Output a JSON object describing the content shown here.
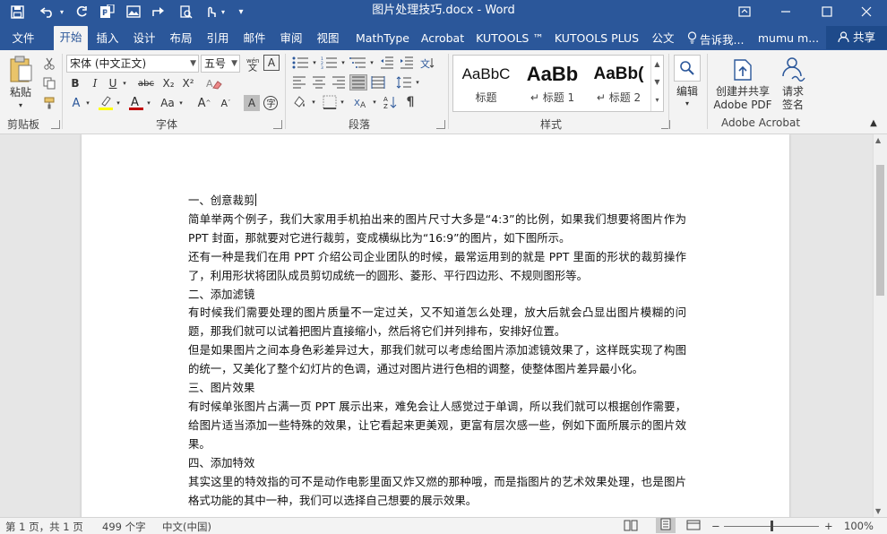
{
  "window": {
    "title": "图片处理技巧.docx - Word",
    "quick_access": [
      "save-icon",
      "undo-icon",
      "redo-icon",
      "pdf-icon",
      "picture-icon",
      "share-icon",
      "print-preview-icon",
      "touch-mode-icon",
      "customize-icon"
    ],
    "controls": [
      "ribbon-display-icon",
      "minimize-icon",
      "maximize-icon",
      "close-icon"
    ]
  },
  "tabs": [
    {
      "label": "文件",
      "active": false
    },
    {
      "label": "开始",
      "active": true
    },
    {
      "label": "插入",
      "active": false
    },
    {
      "label": "设计",
      "active": false
    },
    {
      "label": "布局",
      "active": false
    },
    {
      "label": "引用",
      "active": false
    },
    {
      "label": "邮件",
      "active": false
    },
    {
      "label": "审阅",
      "active": false
    },
    {
      "label": "视图",
      "active": false
    },
    {
      "label": "MathType",
      "active": false
    },
    {
      "label": "Acrobat",
      "active": false
    },
    {
      "label": "KUTOOLS ™",
      "active": false
    },
    {
      "label": "KUTOOLS PLUS",
      "active": false
    },
    {
      "label": "公文",
      "active": false
    }
  ],
  "tell_me": "告诉我...",
  "user": "mumu m...",
  "share": "共享",
  "ribbon": {
    "clipboard": {
      "paste": "粘贴",
      "label": "剪贴板"
    },
    "font": {
      "name": "宋体 (中文正文)",
      "size": "五号",
      "label": "字体",
      "buttons": [
        "B",
        "I",
        "U",
        "abc",
        "X₂",
        "X²",
        "Aa",
        "A"
      ]
    },
    "paragraph": {
      "label": "段落"
    },
    "styles": {
      "label": "样式",
      "items": [
        {
          "sample": "AaBbC",
          "name": "标题"
        },
        {
          "sample": "AaBb",
          "name": "↵ 标题 1"
        },
        {
          "sample": "AaBb(",
          "name": "↵ 标题 2"
        }
      ]
    },
    "editing": {
      "label": "编辑"
    },
    "acrobat": {
      "create_share_line1": "创建并共享",
      "create_share_line2": "Adobe PDF",
      "sign_line1": "请求",
      "sign_line2": "签名",
      "label": "Adobe Acrobat"
    }
  },
  "document": {
    "paragraphs": [
      "一、创意裁剪",
      "简单举两个例子，我们大家用手机拍出来的图片尺寸大多是“4:3”的比例，如果我们想要将图片作为 PPT 封面，那就要对它进行裁剪，变成横纵比为“16:9”的图片，如下图所示。",
      "还有一种是我们在用 PPT 介绍公司企业团队的时候，最常运用到的就是 PPT 里面的形状的裁剪操作了，利用形状将团队成员剪切成统一的圆形、菱形、平行四边形、不规则图形等。",
      "二、添加滤镜",
      "有时候我们需要处理的图片质量不一定过关，又不知道怎么处理，放大后就会凸显出图片模糊的问题，那我们就可以试着把图片直接缩小，然后将它们并列排布，安排好位置。",
      "但是如果图片之间本身色彩差异过大，那我们就可以考虑给图片添加滤镜效果了，这样既实现了构图的统一，又美化了整个幻灯片的色调，通过对图片进行色相的调整，使整体图片差异最小化。",
      "三、图片效果",
      "有时候单张图片占满一页 PPT 展示出来，难免会让人感觉过于单调，所以我们就可以根据创作需要，给图片适当添加一些特殊的效果，让它看起来更美观，更富有层次感一些，例如下面所展示的图片效果。",
      "四、添加特效",
      "其实这里的特效指的可不是动作电影里面又炸又燃的那种哦，而是指图片的艺术效果处理，也是图片格式功能的其中一种，我们可以选择自己想要的展示效果。"
    ]
  },
  "status": {
    "page": "第 1 页，共 1 页",
    "words": "499 个字",
    "language": "中文(中国)",
    "zoom": "100%",
    "zoom_level": 1.0
  },
  "colors": {
    "accent": "#2b579a",
    "ribbon_bg": "#f3f3f3",
    "doc_bg": "#e6e6e6",
    "font_color_bar": "#c00000",
    "highlight_bar": "#ffff00"
  }
}
